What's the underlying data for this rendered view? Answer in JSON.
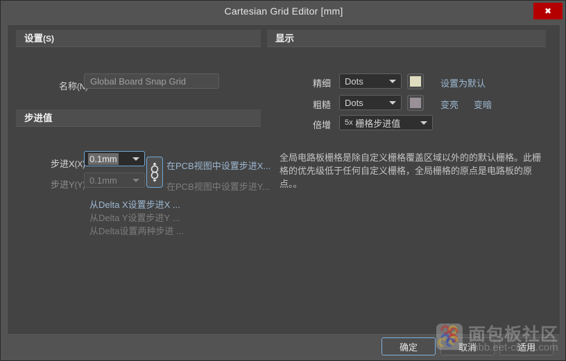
{
  "window": {
    "title": "Cartesian Grid Editor [mm]",
    "close_label": "✖"
  },
  "settings_group": {
    "title": "设置",
    "mnemonic": "(S)",
    "name_label": "名称",
    "name_mnemonic": "(N)",
    "name_value": "",
    "name_placeholder": "Global Board Snap Grid"
  },
  "step_group": {
    "title": "步进值",
    "step_x_label": "步进X",
    "step_x_mnemonic": "(X)",
    "step_x_value": "0.1mm",
    "step_y_label": "步进Y",
    "step_y_mnemonic": "(Y)",
    "step_y_value": "0.1mm",
    "link_icon": "chain-link-icon",
    "link_pcb_x": "在PCB视图中设置步进X...",
    "link_pcb_y": "在PCB视图中设置步进Y...",
    "link_delta_x": "从Delta X设置步进X ...",
    "link_delta_y": "从Delta Y设置步进Y ...",
    "link_delta_both": "从Delta设置两种步进 ..."
  },
  "display_group": {
    "title": "显示",
    "fine_label": "精细",
    "fine_value": "Dots",
    "fine_color": "#e0dcc0",
    "coarse_label": "粗糙",
    "coarse_value": "Dots",
    "coarse_color": "#9a9098",
    "multiplier_label": "倍增",
    "multiplier_prefix": "5x",
    "multiplier_value": "栅格步进值",
    "set_default_link": "设置为默认",
    "lighten_link": "变亮",
    "darken_link": "变暗",
    "description": "全局电路板栅格是除自定义栅格覆盖区域以外的的默认栅格。此栅格的优先级低于任何自定义栅格，全局栅格的原点是电路板的原点。。"
  },
  "footer": {
    "ok_label": "确定",
    "cancel_label": "取消",
    "apply_label": "适用"
  },
  "watermark": {
    "title": "面包板社区",
    "url": "mbb.eet-china.com"
  }
}
